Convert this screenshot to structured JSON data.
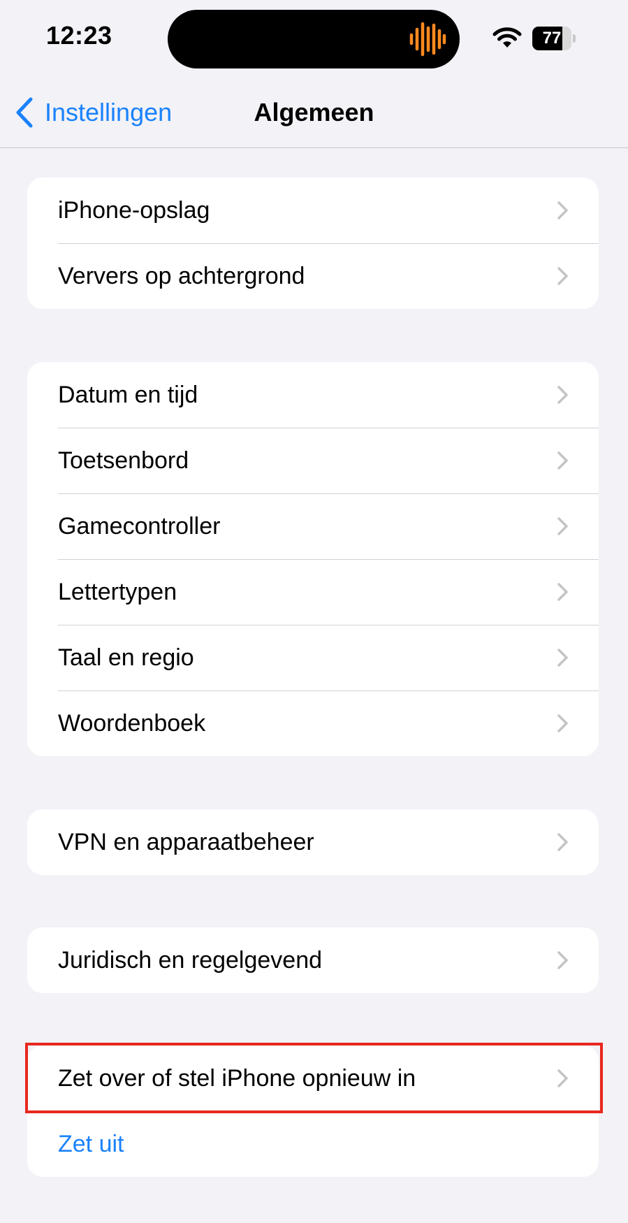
{
  "status_bar": {
    "time": "12:23",
    "battery_level": "77",
    "battery_fraction": 0.77,
    "icons": [
      "waveform-icon",
      "wifi-icon",
      "battery-icon"
    ],
    "colors": {
      "waveform": "#ff8a1f"
    }
  },
  "nav": {
    "back_label": "Instellingen",
    "title": "Algemeen",
    "colors": {
      "accent": "#1a82fb"
    }
  },
  "groups": [
    {
      "items": [
        {
          "label": "iPhone-opslag"
        },
        {
          "label": "Ververs op achtergrond"
        }
      ]
    },
    {
      "items": [
        {
          "label": "Datum en tijd"
        },
        {
          "label": "Toetsenbord"
        },
        {
          "label": "Gamecontroller"
        },
        {
          "label": "Lettertypen"
        },
        {
          "label": "Taal en regio"
        },
        {
          "label": "Woordenboek"
        }
      ]
    },
    {
      "items": [
        {
          "label": "VPN en apparaatbeheer"
        }
      ]
    },
    {
      "items": [
        {
          "label": "Juridisch en regelgevend"
        }
      ]
    },
    {
      "items": [
        {
          "label": "Zet over of stel iPhone opnieuw in"
        }
      ]
    }
  ],
  "shutdown_label": "Zet uit",
  "highlight": {
    "color": "#e8281e",
    "target": "Zet over of stel iPhone opnieuw in"
  }
}
